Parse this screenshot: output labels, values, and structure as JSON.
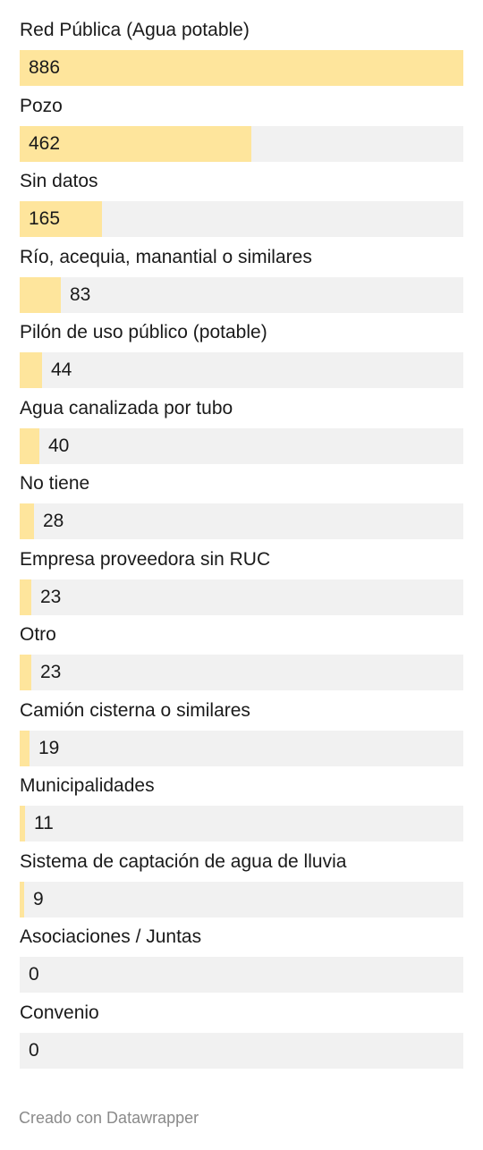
{
  "chart_data": {
    "type": "bar",
    "orientation": "horizontal",
    "categories": [
      "Red Pública (Agua potable)",
      "Pozo",
      "Sin datos",
      "Río, acequia, manantial o similares",
      "Pilón de uso público (potable)",
      "Agua canalizada por tubo",
      "No tiene",
      "Empresa proveedora sin RUC",
      "Otro",
      "Camión cisterna o similares",
      "Municipalidades",
      "Sistema de captación de agua de lluvia",
      "Asociaciones / Juntas",
      "Convenio"
    ],
    "values": [
      886,
      462,
      165,
      83,
      44,
      40,
      28,
      23,
      23,
      19,
      11,
      9,
      0,
      0
    ],
    "xlim": [
      0,
      886
    ],
    "bar_color": "#fee59c",
    "track_color": "#f1f1f1"
  },
  "footer": {
    "credit": "Creado con Datawrapper"
  }
}
